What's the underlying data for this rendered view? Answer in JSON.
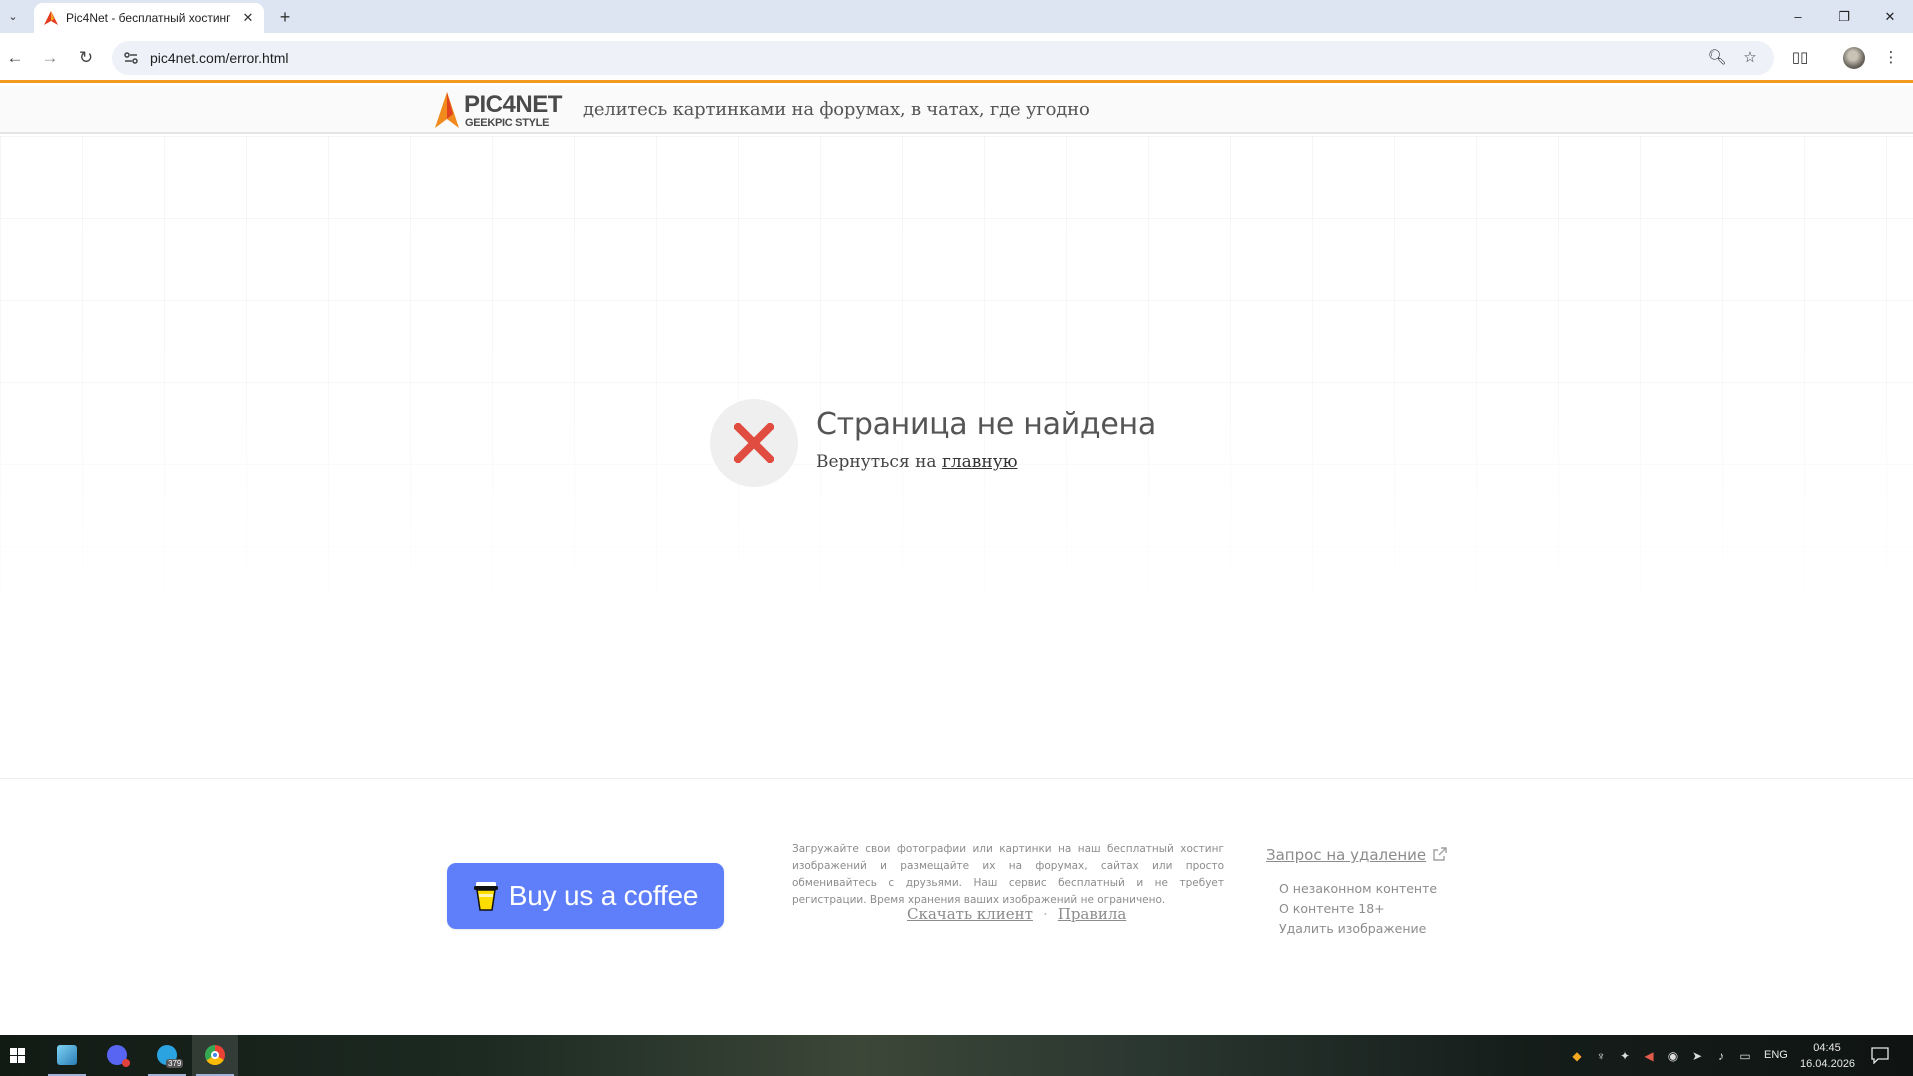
{
  "browser": {
    "tab_title": "Pic4Net - бесплатный хостинг",
    "new_tab_label": "+",
    "url": "pic4net.com/error.html",
    "window_controls": {
      "minimize": "–",
      "restore": "❐",
      "close": "✕"
    }
  },
  "site": {
    "logo_main": "PIC4NET",
    "logo_sub": "GEEKPIC STYLE",
    "tagline": "делитесь картинками на форумах, в чатах, где угодно",
    "brand_color": "#f19a1f"
  },
  "error": {
    "title": "Страница не найдена",
    "subtitle_prefix": "Вернуться на ",
    "home_link": "главную",
    "icon_color": "#e04c40"
  },
  "footer": {
    "coffee_button": "Buy us a coffee",
    "coffee_color": "#5f7ffa",
    "description": "Загружайте свои фотографии или картинки на наш бесплатный хостинг изображений и размещайте их на форумах, сайтах или просто обменивайтесь с друзьями. Наш сервис бесплатный и не требует регистрации. Время хранения ваших изображений не ограничено.",
    "download_client": "Скачать клиент",
    "separator": "·",
    "rules": "Правила",
    "removal_request": "Запрос на удаление",
    "removal_items": [
      "О незаконном контенте",
      "О контенте 18+",
      "Удалить изображение"
    ]
  },
  "taskbar": {
    "language": "ENG",
    "time": "04:45",
    "date": "16.04.2026",
    "telegram_badge": "379"
  }
}
